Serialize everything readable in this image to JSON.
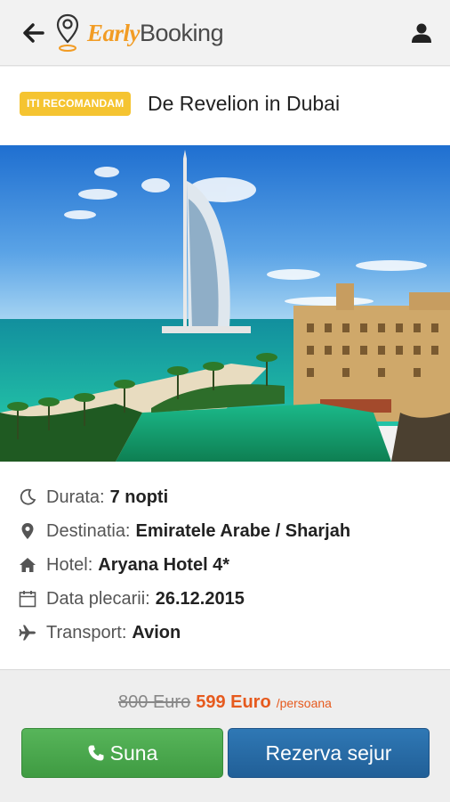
{
  "header": {
    "logo_part1": "Early",
    "logo_part2": "Booking",
    "back_icon": "arrow-left-icon",
    "user_icon": "user-icon",
    "brand_orange": "#f29c24"
  },
  "offer": {
    "badge": "ITI RECOMANDAM",
    "title": "De Revelion in Dubai",
    "badge_color": "#f5c431"
  },
  "details": [
    {
      "icon": "moon-icon",
      "label": "Durata:",
      "value": "7 nopti"
    },
    {
      "icon": "location-pin-icon",
      "label": "Destinatia:",
      "value": "Emiratele Arabe / Sharjah"
    },
    {
      "icon": "home-icon",
      "label": "Hotel:",
      "value": "Aryana Hotel 4*"
    },
    {
      "icon": "calendar-icon",
      "label": "Data plecarii:",
      "value": "26.12.2015"
    },
    {
      "icon": "plane-icon",
      "label": "Transport:",
      "value": "Avion"
    }
  ],
  "pricing": {
    "old_price": "800 Euro",
    "new_price": "599 Euro",
    "per": "/persoana",
    "accent": "#e65a1e"
  },
  "actions": {
    "call_label": "Suna",
    "book_label": "Rezerva sejur",
    "call_color": "#4caf50",
    "book_color": "#286aa6"
  }
}
